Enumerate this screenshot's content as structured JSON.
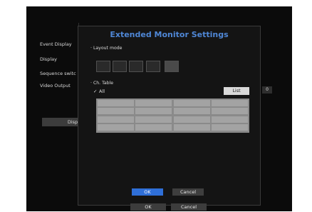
{
  "dialog": {
    "title": "Extended Monitor Settings",
    "layout_mode_label": "Layout mode",
    "ch_table_label": "Ch. Table",
    "all_label": "All",
    "list_button": "List",
    "ok_button": "OK",
    "cancel_button": "Cancel",
    "layout_options_count": 5,
    "selected_layout_index": 4,
    "all_checked": true
  },
  "background": {
    "sidebar_items": [
      "Event Display",
      "Display",
      "Sequence switc",
      "Video Output"
    ],
    "display_button": "Displ",
    "small_button": "0",
    "ok_button": "OK",
    "cancel_button": "Cancel"
  },
  "colors": {
    "accent": "#4f87d6",
    "ok_button": "#2f6fd8",
    "dialog_bg": "#141414"
  }
}
